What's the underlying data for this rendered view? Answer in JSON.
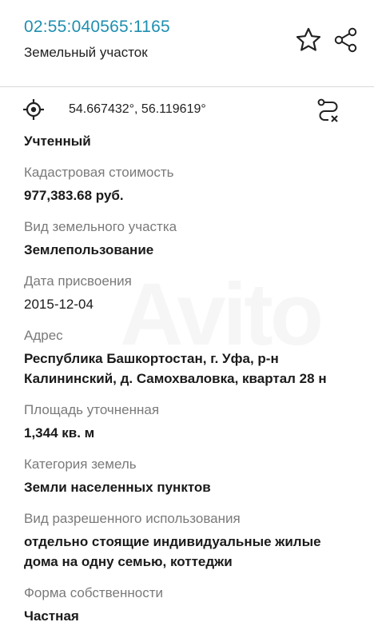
{
  "header": {
    "cadastral_number": "02:55:040565:1165",
    "object_type": "Земельный участок"
  },
  "icons": {
    "favorite": "star-outline-icon",
    "share": "share-icon",
    "locate": "crosshair-target-icon",
    "route": "route-close-icon"
  },
  "coords": {
    "text": "54.667432°, 56.119619°"
  },
  "status": {
    "value": "Учтенный"
  },
  "fields": [
    {
      "label": "Кадастровая стоимость",
      "value": "977,383.68 руб."
    },
    {
      "label": "Вид земельного участка",
      "value": "Землепользование"
    },
    {
      "label": "Дата присвоения",
      "value": "2015-12-04"
    },
    {
      "label": "Адрес",
      "value": "Республика Башкортостан, г. Уфа, р-н Калининский, д. Самохваловка, квартал 28 н"
    },
    {
      "label": "Площадь уточненная",
      "value": "1,344 кв. м"
    },
    {
      "label": "Категория земель",
      "value": "Земли населенных пунктов"
    },
    {
      "label": "Вид разрешенного использования",
      "value": "отдельно стоящие индивидуальные жилые дома на одну семью, коттеджи"
    },
    {
      "label": "Форма собственности",
      "value": "Частная"
    }
  ],
  "colors": {
    "accent": "#1f8fb0",
    "label": "#7a7a7a",
    "text": "#1a1a1a"
  }
}
